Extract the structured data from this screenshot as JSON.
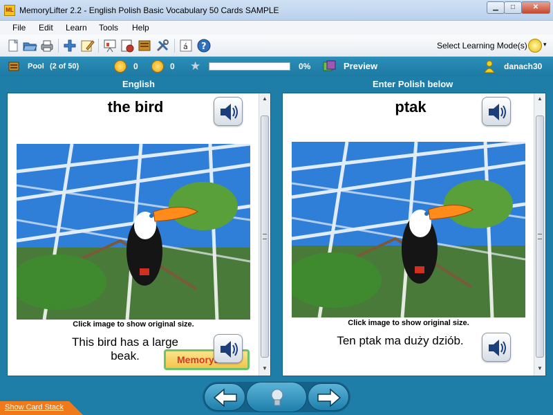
{
  "window": {
    "title": "MemoryLifter 2.2 - English Polish Basic Vocabulary 50 Cards SAMPLE",
    "app_icon_text": "ML",
    "minimize_glyph": "▁",
    "maximize_glyph": "□",
    "close_glyph": "✕"
  },
  "menu": {
    "items": [
      "File",
      "Edit",
      "Learn",
      "Tools",
      "Help"
    ]
  },
  "toolbar": {
    "icons": [
      "new-icon",
      "open-icon",
      "print-icon",
      "add-icon",
      "edit-icon",
      "presentation-icon",
      "statistics-icon",
      "card-box-icon",
      "settings-tools-icon",
      "font-icon",
      "help-icon"
    ],
    "learning_mode_label": "Select Learning Mode(s)",
    "learning_mode_icon": "gear-smiley-icon"
  },
  "status": {
    "pool_label": "Pool",
    "pool_count": "(2 of 50)",
    "right_count": "0",
    "wrong_count": "0",
    "progress_percent": 0,
    "progress_text": "0%",
    "preview_label": "Preview",
    "user_name": "danach30"
  },
  "columns": {
    "left_header": "English",
    "right_header": "Enter Polish below"
  },
  "card_left": {
    "word": "the bird",
    "caption": "Click image to show original size.",
    "sentence_line1": "This bird has a large",
    "sentence_line2": "beak.",
    "brand": "MemoryLifter"
  },
  "card_right": {
    "word": "ptak",
    "caption": "Click image to show original size.",
    "sentence": "Ten ptak ma duży dziób."
  },
  "bottom": {
    "show_card_stack": "Show Card Stack"
  },
  "colors": {
    "accent": "#1f7ea8",
    "statusbar": "#2b8fb9",
    "stack_tab": "#f07a1a"
  }
}
